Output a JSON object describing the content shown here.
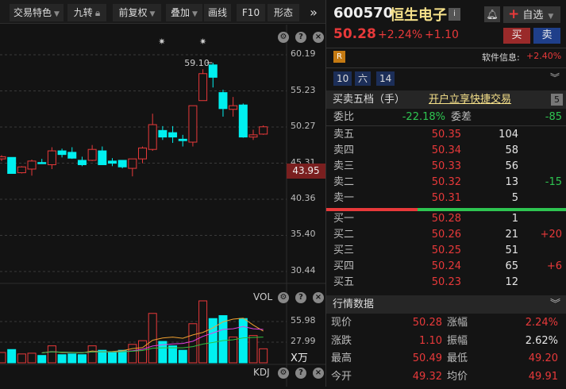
{
  "toolbar": {
    "items": [
      {
        "label": "交易特色",
        "caret": true
      },
      {
        "label": "九转",
        "lock": true
      },
      {
        "label": "前复权",
        "caret": true
      },
      {
        "label": "叠加",
        "caret": true
      },
      {
        "label": "画线"
      },
      {
        "label": "F10"
      },
      {
        "label": "形态"
      },
      {
        "label": "»"
      }
    ]
  },
  "chart_icons": [
    "gear-icon",
    "help-icon",
    "close-icon"
  ],
  "chart_data": [
    {
      "type": "candlestick",
      "y_ticks": [
        "60.19",
        "55.23",
        "50.27",
        "45.31",
        "40.36",
        "35.40",
        "30.44"
      ],
      "ylim": [
        30.44,
        60.19
      ],
      "high_label": "59.10",
      "current_price_label": "43.95",
      "candles": [
        [
          45.9,
          46.4,
          45.6,
          46.2
        ],
        [
          46.1,
          46.1,
          43.9,
          43.9
        ],
        [
          44.0,
          44.9,
          43.9,
          44.8
        ],
        [
          44.5,
          45.8,
          43.6,
          45.6
        ],
        [
          45.4,
          45.9,
          45.3,
          45.3
        ],
        [
          45.1,
          47.5,
          44.5,
          47.0
        ],
        [
          47.0,
          47.3,
          46.1,
          46.5
        ],
        [
          46.8,
          47.5,
          45.9,
          46.0
        ],
        [
          45.7,
          46.2,
          44.9,
          45.1
        ],
        [
          45.7,
          47.8,
          45.6,
          47.2
        ],
        [
          47.0,
          47.6,
          45.1,
          45.1
        ],
        [
          45.6,
          46.0,
          44.9,
          45.3
        ],
        [
          45.7,
          45.7,
          44.6,
          44.8
        ],
        [
          44.6,
          45.9,
          43.5,
          45.9
        ],
        [
          45.9,
          47.6,
          45.3,
          47.4
        ],
        [
          47.2,
          52.1,
          47.0,
          50.6
        ],
        [
          49.8,
          50.4,
          48.5,
          48.9
        ],
        [
          49.5,
          50.4,
          48.1,
          48.9
        ],
        [
          48.6,
          49.2,
          47.6,
          48.4
        ],
        [
          48.2,
          53.2,
          47.6,
          53.2
        ],
        [
          53.9,
          58.2,
          53.9,
          57.6
        ],
        [
          58.8,
          59.1,
          55.7,
          57.1
        ],
        [
          55.0,
          55.4,
          51.7,
          52.8
        ],
        [
          52.7,
          54.4,
          51.7,
          53.2
        ],
        [
          53.3,
          53.5,
          48.8,
          48.9
        ],
        [
          48.9,
          49.9,
          48.5,
          49.2
        ],
        [
          49.3,
          50.5,
          49.2,
          50.3
        ]
      ],
      "star_markers_at": [
        16,
        20
      ]
    },
    {
      "type": "bar",
      "title": "VOL",
      "unit": "X万",
      "y_ticks": [
        "55.98",
        "27.99"
      ],
      "ylim": [
        0,
        84
      ],
      "values": [
        14,
        18,
        12,
        13,
        10,
        23,
        11,
        12,
        11,
        23,
        17,
        14,
        17,
        25,
        30,
        67,
        29,
        23,
        17,
        53,
        84,
        60,
        64,
        35,
        60,
        37,
        19
      ],
      "ma_colors": {
        "ma5": "#f0a030",
        "ma10": "#e040e0",
        "ma20": "#30c040"
      }
    }
  ],
  "kdj_label": "KDJ",
  "quote": {
    "code": "600570",
    "name": "恒生电子",
    "info_icon": "i",
    "price": "50.28",
    "pct": "+2.24%",
    "change": "+1.10",
    "watch_label": "自选",
    "buy_label": "买",
    "sell_label": "卖",
    "r_badge": "R",
    "software_info_label": "软件信息:",
    "software_info_value": "+2.40%",
    "tags": [
      "10",
      "六",
      "14"
    ]
  },
  "orderbook": {
    "title": "买卖五档（手）",
    "promo": "开户立享快捷交易",
    "level_badge": "5",
    "weibi_label": "委比",
    "weibi": "-22.18%",
    "weicha_label": "委差",
    "weicha": "-85",
    "asks": [
      {
        "label": "卖五",
        "price": "50.35",
        "vol": "104",
        "chg": ""
      },
      {
        "label": "卖四",
        "price": "50.34",
        "vol": "58",
        "chg": ""
      },
      {
        "label": "卖三",
        "price": "50.33",
        "vol": "56",
        "chg": ""
      },
      {
        "label": "卖二",
        "price": "50.32",
        "vol": "13",
        "chg": "-15"
      },
      {
        "label": "卖一",
        "price": "50.31",
        "vol": "5",
        "chg": ""
      }
    ],
    "bids": [
      {
        "label": "买一",
        "price": "50.28",
        "vol": "1",
        "chg": ""
      },
      {
        "label": "买二",
        "price": "50.26",
        "vol": "21",
        "chg": "+20"
      },
      {
        "label": "买三",
        "price": "50.25",
        "vol": "51",
        "chg": ""
      },
      {
        "label": "买四",
        "price": "50.24",
        "vol": "65",
        "chg": "+6"
      },
      {
        "label": "买五",
        "price": "50.23",
        "vol": "12",
        "chg": ""
      }
    ],
    "bid_ratio": 0.38
  },
  "market": {
    "title": "行情数据",
    "rows": [
      {
        "l1": "现价",
        "v1": "50.28",
        "l2": "涨幅",
        "v2": "2.24%",
        "c2": "red"
      },
      {
        "l1": "涨跌",
        "v1": "1.10",
        "l2": "振幅",
        "v2": "2.62%",
        "c2": "white"
      },
      {
        "l1": "最高",
        "v1": "50.49",
        "l2": "最低",
        "v2": "49.20",
        "c2": "red"
      },
      {
        "l1": "今开",
        "v1": "49.32",
        "l2": "均价",
        "v2": "49.91",
        "c2": "red"
      }
    ]
  },
  "colors": {
    "up": "#e8393a",
    "down": "#00f0f0",
    "accent_yellow": "#f5e08a"
  }
}
